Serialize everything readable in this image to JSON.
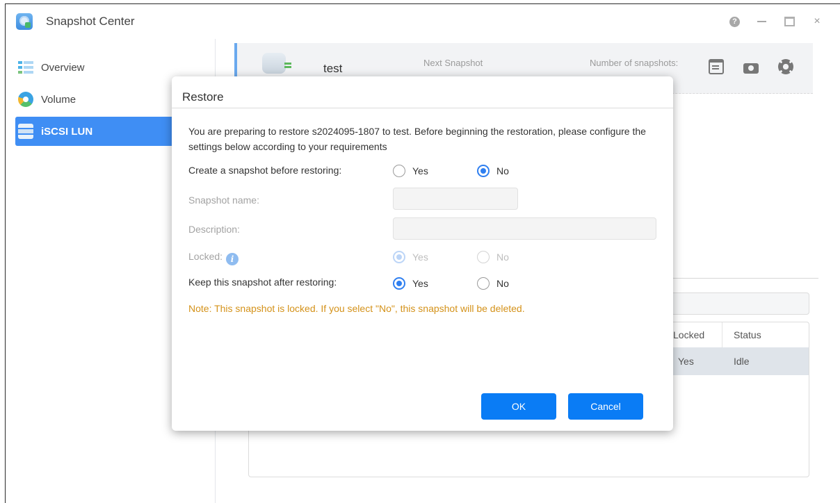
{
  "window": {
    "title": "Snapshot Center",
    "icon": "snapshot-center-app-icon",
    "controls": {
      "help": "?",
      "close": "×"
    }
  },
  "sidebar": {
    "items": [
      {
        "label": "Overview",
        "icon": "overview-icon"
      },
      {
        "label": "Volume",
        "icon": "volume-pie-icon"
      },
      {
        "label": "iSCSI LUN",
        "icon": "lun-disk-icon",
        "active": true
      }
    ]
  },
  "lun_card": {
    "name": "test",
    "next_snapshot_label": "Next Snapshot",
    "num_snapshots_label": "Number of snapshots:",
    "tools": [
      "schedule-icon",
      "take-snapshot-icon",
      "settings-gear-icon"
    ]
  },
  "table": {
    "headers": {
      "locked": "Locked",
      "status": "Status"
    },
    "rows": [
      {
        "locked": "Yes",
        "status": "Idle"
      }
    ]
  },
  "dialog": {
    "title": "Restore",
    "intro": "You are preparing to restore s2024095-1807 to test. Before beginning the restoration, please configure the settings below according to your requirements",
    "create_snapshot": {
      "label": "Create a snapshot before restoring:",
      "yes": "Yes",
      "no": "No",
      "selected": "No"
    },
    "snapshot_name": {
      "label": "Snapshot name:",
      "value": ""
    },
    "description": {
      "label": "Description:",
      "value": ""
    },
    "locked": {
      "label": "Locked:",
      "info_icon": "i",
      "yes": "Yes",
      "no": "No",
      "selected": "Yes",
      "disabled": true
    },
    "keep_snapshot": {
      "label": "Keep this snapshot after restoring:",
      "yes": "Yes",
      "no": "No",
      "selected": "Yes"
    },
    "note": "Note: This snapshot is locked. If you select \"No\", this snapshot will be deleted.",
    "ok_label": "OK",
    "cancel_label": "Cancel"
  },
  "colors": {
    "accent": "#0a7cf5",
    "sidebar_active": "#3f8ef4",
    "note": "#d4921a"
  }
}
